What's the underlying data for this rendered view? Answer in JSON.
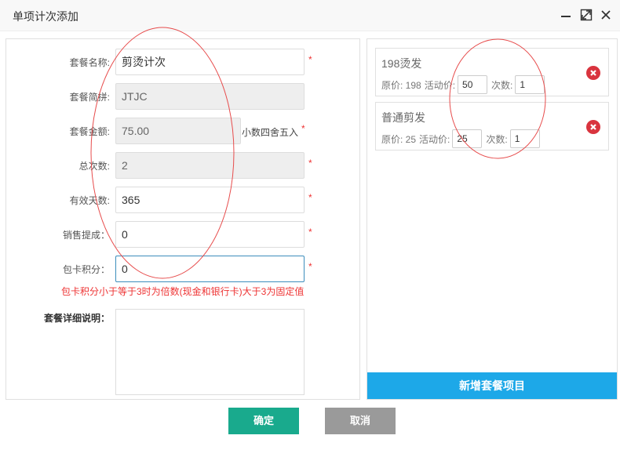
{
  "window": {
    "title": "单项计次添加"
  },
  "form": {
    "name_label": "套餐名称:",
    "name_value": "剪烫计次",
    "abbr_label": "套餐简拼:",
    "abbr_value": "JTJC",
    "amount_label": "套餐金额:",
    "amount_value": "75.00",
    "amount_hint": "小数四舍五入",
    "total_label": "总次数:",
    "total_value": "2",
    "days_label": "有效天数:",
    "days_value": "365",
    "commission_label": "销售提成：",
    "commission_value": "0",
    "points_label": "包卡积分：",
    "points_value": "0",
    "points_note": "包卡积分小于等于3时为倍数(现金和银行卡)大于3为固定值",
    "detail_label": "套餐详细说明：",
    "required_mark": "*"
  },
  "items": [
    {
      "name": "198烫发",
      "original_price_text": "原价: 198",
      "activity_label": "活动价:",
      "activity_price": "50",
      "count_label": "次数:",
      "count": "1"
    },
    {
      "name": "普通剪发",
      "original_price_text": "原价: 25",
      "activity_label": "活动价:",
      "activity_price": "25",
      "count_label": "次数:",
      "count": "1"
    }
  ],
  "add_item_label": "新增套餐项目",
  "buttons": {
    "confirm": "确定",
    "cancel": "取消"
  },
  "colors": {
    "accent_blue": "#1da8e8",
    "confirm_green": "#19aa8d",
    "cancel_gray": "#9a9a9a",
    "required_red": "#e33333",
    "delete_red": "#d9343e",
    "annotation_red": "#e74c4c"
  },
  "icons": {
    "minimize": "minimize-icon",
    "maximize": "maximize-icon",
    "close": "close-icon",
    "delete": "delete-circle-icon"
  }
}
